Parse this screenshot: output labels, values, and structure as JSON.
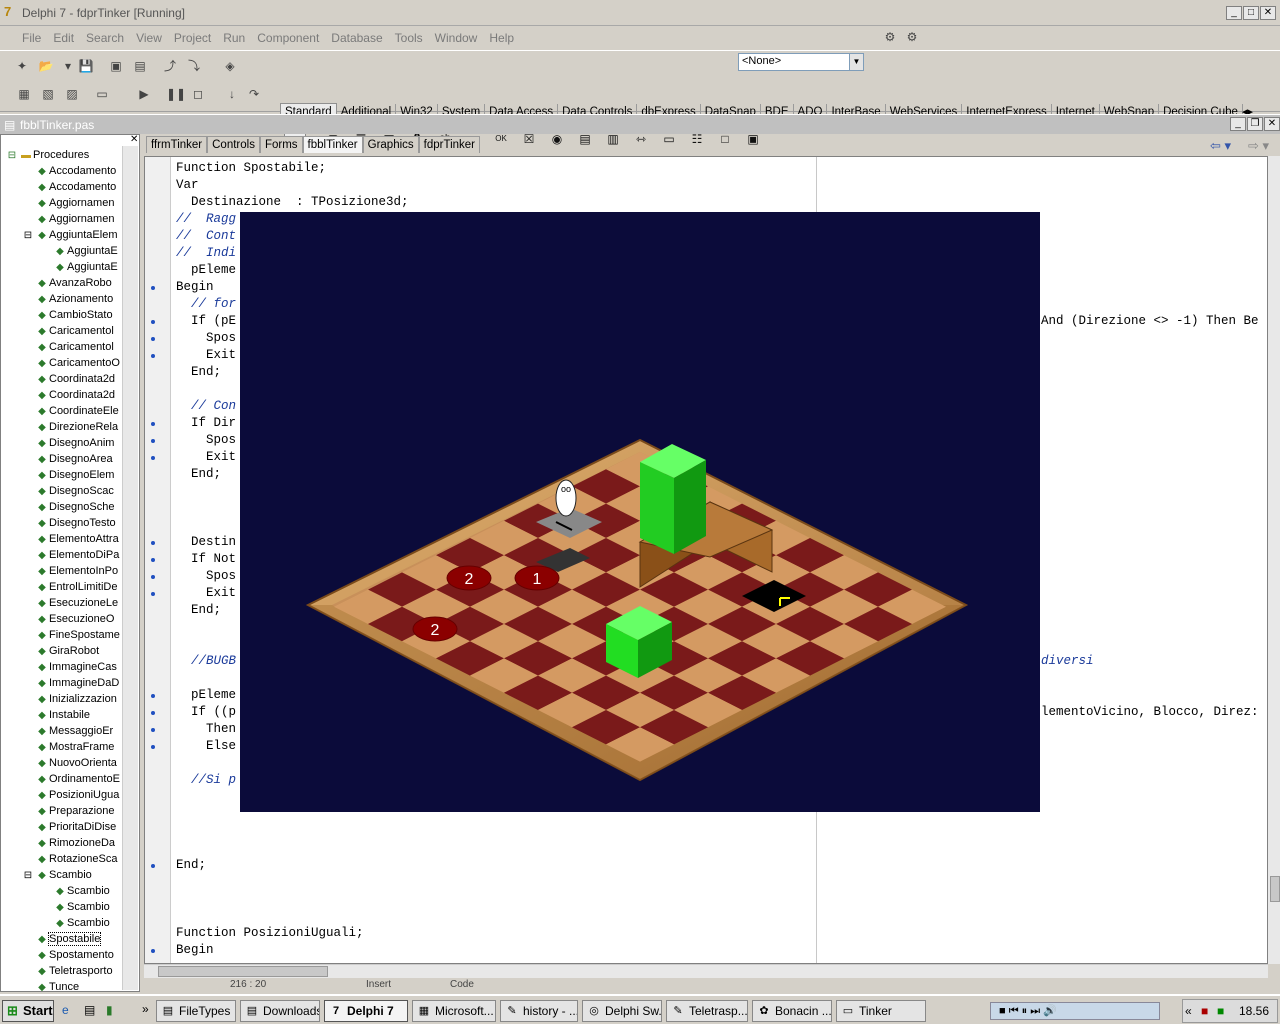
{
  "window": {
    "title": "Delphi 7 - fdprTinker [Running]",
    "min": "_",
    "max": "□",
    "close": "✕"
  },
  "menu": [
    "File",
    "Edit",
    "Search",
    "View",
    "Project",
    "Run",
    "Component",
    "Database",
    "Tools",
    "Window",
    "Help"
  ],
  "toolbar": {
    "combo_value": "<None>"
  },
  "palette_tabs": [
    "Standard",
    "Additional",
    "Win32",
    "System",
    "Data Access",
    "Data Controls",
    "dbExpress",
    "DataSnap",
    "BDE",
    "ADO",
    "InterBase",
    "WebServices",
    "InternetExpress",
    "Internet",
    "WebSnap",
    "Decision Cube"
  ],
  "editor": {
    "file_title": "fbblTinker.pas",
    "tabs": [
      "ffrmTinker",
      "Controls",
      "Forms",
      "fbblTinker",
      "Graphics",
      "fdprTinker"
    ],
    "status_pos": "216 : 20",
    "status_mode": "Insert",
    "status_code": "Code"
  },
  "tree": {
    "root": "Procedures",
    "items": [
      "Accodamento",
      "Accodamento",
      "Aggiornamen",
      "Aggiornamen",
      "AggiuntaElem",
      "AggiuntaE",
      "AggiuntaE",
      "AvanzaRobo",
      "Azionamento",
      "CambioStato",
      "Caricamentol",
      "Caricamentol",
      "CaricamentoO",
      "Coordinata2d",
      "Coordinata2d",
      "CoordinateEle",
      "DirezioneRela",
      "DisegnoAnim",
      "DisegnoArea",
      "DisegnoElem",
      "DisegnoScac",
      "DisegnoSche",
      "DisegnoTesto",
      "ElementoAttra",
      "ElementoDiPa",
      "ElementoInPo",
      "EntrolLimitiDe",
      "EsecuzioneLe",
      "EsecuzioneO",
      "FineSpostame",
      "GiraRobot",
      "ImmagineCas",
      "ImmagineDaD",
      "Inizializzazion",
      "Instabile",
      "MessaggioEr",
      "MostraFrame",
      "NuovoOrienta",
      "OrdinamentoE",
      "PosizioniUgua",
      "Preparazione",
      "PrioritaDiDise",
      "RimozioneDa",
      "RotazioneSca",
      "Scambio",
      "Scambio",
      "Scambio",
      "Scambio",
      "Spostabile",
      "Spostamento",
      "Teletrasporto",
      "Tunce"
    ]
  },
  "code": [
    {
      "t": "Function Spostabile;",
      "c": false
    },
    {
      "t": "Var",
      "c": false
    },
    {
      "t": "  Destinazione  : TPosizione3d;",
      "c": false
    },
    {
      "t": "//  Ragg",
      "c": true
    },
    {
      "t": "//  Cont",
      "c": true
    },
    {
      "t": "//  Indi",
      "c": true
    },
    {
      "t": "  pEleme",
      "c": false
    },
    {
      "t": "Begin",
      "c": false
    },
    {
      "t": "  // for",
      "c": true
    },
    {
      "t": "  If (pE",
      "c": false
    },
    {
      "t": "    Spos",
      "c": false
    },
    {
      "t": "    Exit",
      "c": false
    },
    {
      "t": "  End;",
      "c": false
    },
    {
      "t": "",
      "c": false
    },
    {
      "t": "  // Con",
      "c": true
    },
    {
      "t": "  If Dir",
      "c": false
    },
    {
      "t": "    Spos",
      "c": false
    },
    {
      "t": "    Exit",
      "c": false
    },
    {
      "t": "  End;",
      "c": false
    },
    {
      "t": "",
      "c": false
    },
    {
      "t": "",
      "c": false
    },
    {
      "t": "",
      "c": false
    },
    {
      "t": "  Destin",
      "c": false
    },
    {
      "t": "  If Not",
      "c": false
    },
    {
      "t": "    Spos",
      "c": false
    },
    {
      "t": "    Exit",
      "c": false
    },
    {
      "t": "  End;",
      "c": false
    },
    {
      "t": "",
      "c": false
    },
    {
      "t": "",
      "c": false
    },
    {
      "t": "  //BUGB",
      "c": true
    },
    {
      "t": "",
      "c": false
    },
    {
      "t": "  pEleme",
      "c": false
    },
    {
      "t": "  If ((p",
      "c": false
    },
    {
      "t": "    Then",
      "c": false
    },
    {
      "t": "    Else",
      "c": false
    },
    {
      "t": "",
      "c": false
    },
    {
      "t": "  //Si p",
      "c": true
    },
    {
      "t": "",
      "c": false
    },
    {
      "t": "",
      "c": false
    },
    {
      "t": "",
      "c": false
    },
    {
      "t": "",
      "c": false
    },
    {
      "t": "End;",
      "c": false
    },
    {
      "t": "",
      "c": false
    },
    {
      "t": "",
      "c": false
    },
    {
      "t": "",
      "c": false
    },
    {
      "t": "Function PosizioniUguali;",
      "c": false
    },
    {
      "t": "Begin",
      "c": false
    }
  ],
  "code_right": [
    {
      "line": 9,
      "t": "And (Direzione <> -1) Then Be",
      "c": false
    },
    {
      "line": 29,
      "t": "diversi",
      "c": true
    },
    {
      "line": 32,
      "t": "lementoVicino, Blocco, Direz:",
      "c": false
    }
  ],
  "game": {
    "badges": [
      "2",
      "1",
      "2"
    ]
  },
  "taskbar": {
    "start": "Start",
    "items": [
      "FileTypes",
      "Downloads",
      "Delphi 7",
      "Microsoft...",
      "history - ...",
      "Delphi Sw...",
      "Teletrasp...",
      "Bonacin ...",
      "Tinker"
    ],
    "clock": "18.56"
  }
}
